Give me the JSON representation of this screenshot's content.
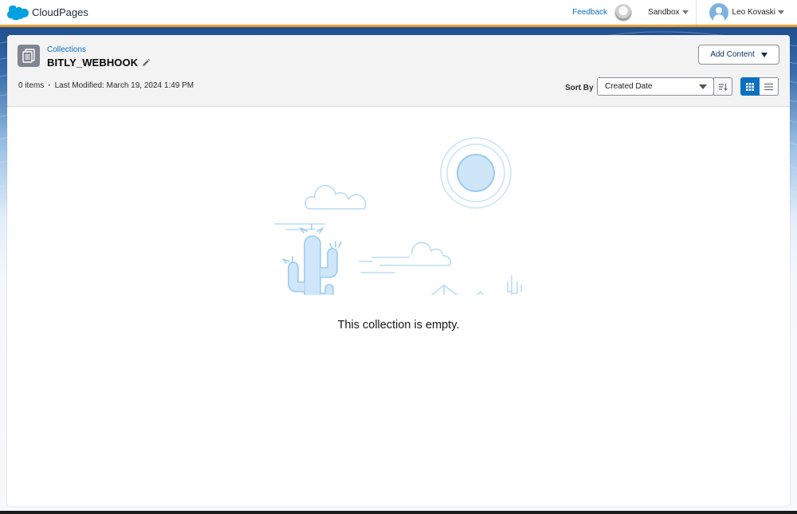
{
  "app": {
    "name": "CloudPages"
  },
  "topbar": {
    "feedback_label": "Feedback",
    "environment_label": "Sandbox",
    "user_name": "Leo Kovaski"
  },
  "header": {
    "breadcrumb": "Collections",
    "title": "BITLY_WEBHOOK",
    "item_count": "0 items",
    "last_modified": "Last Modified: March 19, 2024 1:49 PM",
    "add_content_label": "Add Content",
    "sort_by_label": "Sort By",
    "sort_by_value": "Created Date",
    "active_view": "grid"
  },
  "empty_state": {
    "message": "This collection is empty."
  },
  "icons": {
    "brand": "salesforce-cloud-icon",
    "collection": "collection-icon",
    "edit": "pencil-icon",
    "sort_direction": "sort-descending-icon",
    "grid_view": "grid-view-icon",
    "list_view": "list-view-icon"
  },
  "colors": {
    "brand_blue": "#00A1E0",
    "link_blue": "#0B6FC4",
    "accent_orange": "#F39C2B",
    "banner_navy": "#1E4F8F"
  }
}
